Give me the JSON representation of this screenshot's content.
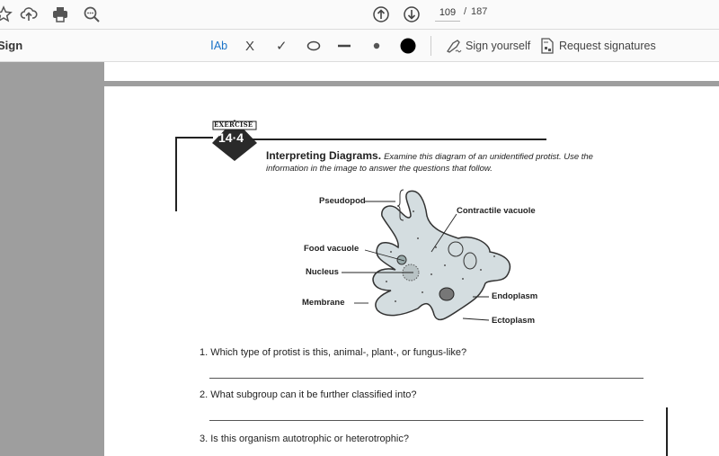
{
  "toolbar": {
    "icons": [
      "bookmark-star-icon",
      "upload-cloud-icon",
      "print-icon",
      "find-zoom-icon"
    ],
    "page_up_icon": "arrow-up-circle-icon",
    "page_down_icon": "arrow-down-circle-icon",
    "current_page": "109",
    "page_separator": "/",
    "total_pages": "187"
  },
  "sign_toolbar": {
    "title": "Sign",
    "tools": [
      {
        "name": "add-text-tool",
        "label": "Ab"
      },
      {
        "name": "cross-mark-tool",
        "label": "X"
      },
      {
        "name": "check-mark-tool",
        "label": "✓"
      },
      {
        "name": "circle-tool",
        "label": ""
      },
      {
        "name": "line-tool",
        "label": ""
      },
      {
        "name": "dot-tool",
        "label": ""
      },
      {
        "name": "color-picker",
        "label": ""
      }
    ],
    "sign_yourself": "Sign yourself",
    "request_signatures": "Request signatures",
    "accent": "#1a73c8",
    "color_selected": "#000000"
  },
  "document": {
    "exercise_badge": {
      "label": "EXERCISE",
      "number": "14·4"
    },
    "heading_bold": "Interpreting Diagrams.",
    "heading_italic": "Examine this diagram of an unidentified protist. Use the information in the image to answer the questions that follow.",
    "diagram_labels": {
      "pseudopod": "Pseudopod",
      "contractile_vacuole": "Contractile vacuole",
      "food_vacuole": "Food vacuole",
      "nucleus": "Nucleus",
      "membrane": "Membrane",
      "endoplasm": "Endoplasm",
      "ectoplasm": "Ectoplasm"
    },
    "questions": [
      "1.  Which type of protist is this, animal-, plant-, or fungus-like?",
      "2.  What subgroup can it be further classified into?",
      "3.  Is this organism autotrophic or heterotrophic?"
    ]
  }
}
